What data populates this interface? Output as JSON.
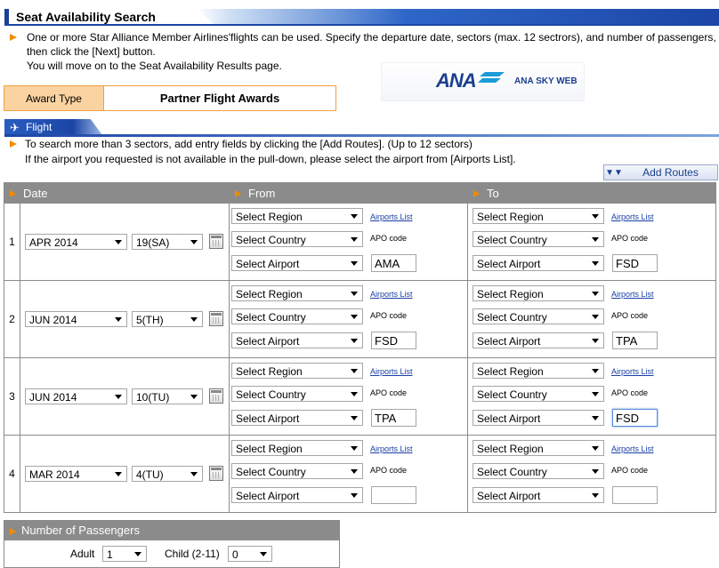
{
  "header": {
    "title": "Seat Availability Search"
  },
  "intro": {
    "line1": "One or more Star Alliance Member Airlines'flights can be used. Specify the departure date, sectors (max. 12 sectrors), and number of passengers, then click the [Next] button.",
    "line2": "You will move on to the Seat Availability Results page."
  },
  "logo": {
    "brand": "ANA",
    "tagline": "ANA SKY WEB"
  },
  "award": {
    "label": "Award Type",
    "value": "Partner Flight Awards"
  },
  "flight_section": {
    "title": "Flight",
    "icon": "airplane-icon"
  },
  "note": {
    "line1": "To search more than 3 sectors, add entry fields by clicking the [Add Routes]. (Up to 12 sectors)",
    "line2": "If the airport you requested is not available in the pull-down, please select the airport from [Airports List]."
  },
  "add_routes": {
    "label": "Add Routes"
  },
  "table": {
    "col_date": "Date",
    "col_from": "From",
    "col_to": "To"
  },
  "common": {
    "select_region": "Select Region",
    "select_country": "Select Country",
    "select_airport": "Select Airport",
    "airports_list": "Airports List",
    "apo_code": "APO code"
  },
  "routes": [
    {
      "num": "1",
      "month": "APR 2014",
      "day": "19(SA)",
      "from_code": "AMA",
      "to_code": "FSD"
    },
    {
      "num": "2",
      "month": "JUN 2014",
      "day": "5(TH)",
      "from_code": "FSD",
      "to_code": "TPA"
    },
    {
      "num": "3",
      "month": "JUN 2014",
      "day": "10(TU)",
      "from_code": "TPA",
      "to_code": "FSD"
    },
    {
      "num": "4",
      "month": "MAR 2014",
      "day": "4(TU)",
      "from_code": "",
      "to_code": ""
    }
  ],
  "passengers": {
    "title": "Number of Passengers",
    "adult_label": "Adult",
    "adult_value": "1",
    "child_label": "Child (2-11)",
    "child_value": "0"
  },
  "colors": {
    "brand_blue": "#1b46a6",
    "accent_orange": "#f08c00",
    "award_label_bg": "#fbd3a0",
    "table_header": "#8b8b8b"
  }
}
